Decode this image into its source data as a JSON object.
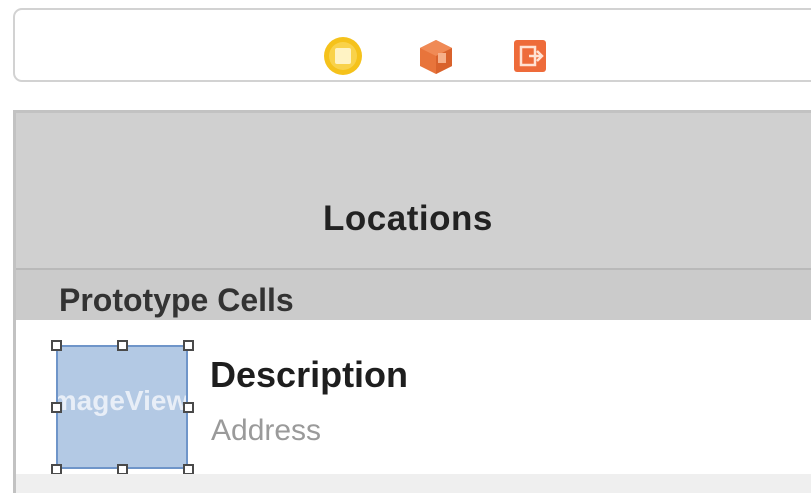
{
  "scene_dock": {
    "icons": [
      {
        "name": "view-controller-icon",
        "color": "#F5C21B"
      },
      {
        "name": "first-responder-icon",
        "color": "#E8743B"
      },
      {
        "name": "exit-icon",
        "color": "#EE6B3A"
      }
    ]
  },
  "table_view_controller": {
    "nav_title": "Locations",
    "section_header": "Prototype Cells",
    "cell": {
      "image_view_label": "ImageView",
      "title_label": "Description",
      "subtitle_label": "Address"
    }
  },
  "colors": {
    "nav_bar_background": "#D0D0D0",
    "selection_fill": "#B3C9E4",
    "selection_border": "#6F95C9"
  }
}
